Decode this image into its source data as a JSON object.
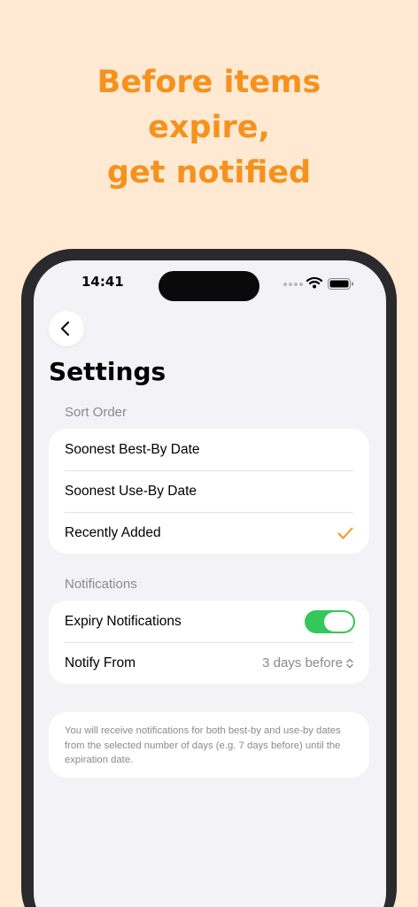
{
  "promo": {
    "line1": "Before items",
    "line2": "expire,",
    "line3": "get notified",
    "color": "#F5921E",
    "background": "#FFE9D2"
  },
  "status_bar": {
    "time": "14:41",
    "icons": [
      "signal-dots-icon",
      "wifi-icon",
      "battery-icon"
    ]
  },
  "nav": {
    "back_icon": "chevron-left-icon",
    "title": "Settings"
  },
  "sort_order": {
    "label": "Sort Order",
    "options": [
      {
        "label": "Soonest Best-By Date",
        "selected": false
      },
      {
        "label": "Soonest Use-By Date",
        "selected": false
      },
      {
        "label": "Recently Added",
        "selected": true
      }
    ],
    "check_color": "#F5921E"
  },
  "notifications": {
    "label": "Notifications",
    "expiry_label": "Expiry Notifications",
    "expiry_enabled": true,
    "toggle_color": "#34C759",
    "notify_from_label": "Notify From",
    "notify_from_value": "3 days before"
  },
  "note": {
    "text": "You will receive notifications for both best-by and use-by dates from the selected number of days (e.g. 7 days before) until the expiration date."
  }
}
